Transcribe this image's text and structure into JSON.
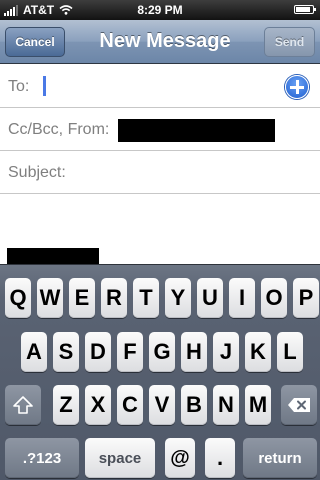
{
  "status_bar": {
    "carrier": "AT&T",
    "time": "8:29 PM",
    "signal_bars": 4,
    "battery_level": 0.85
  },
  "nav": {
    "cancel_label": "Cancel",
    "title": "New Message",
    "send_label": "Send"
  },
  "fields": {
    "to_label": "To:",
    "ccbcc_label": "Cc/Bcc, From:",
    "subject_label": "Subject:"
  },
  "keyboard": {
    "row1": [
      "Q",
      "W",
      "E",
      "R",
      "T",
      "Y",
      "U",
      "I",
      "O",
      "P"
    ],
    "row2": [
      "A",
      "S",
      "D",
      "F",
      "G",
      "H",
      "J",
      "K",
      "L"
    ],
    "row3": [
      "Z",
      "X",
      "C",
      "V",
      "B",
      "N",
      "M"
    ],
    "numbers_label": ".?123",
    "space_label": "space",
    "at_label": "@",
    "dot_label": ".",
    "return_label": "return"
  }
}
